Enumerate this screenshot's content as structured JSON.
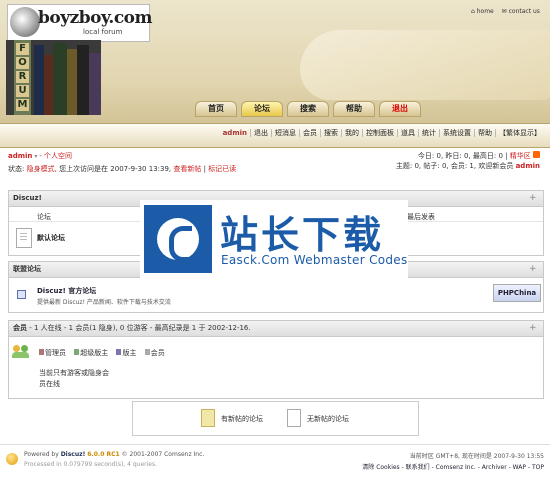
{
  "brand": {
    "title": "boyzboy.com",
    "subtitle": "local forum",
    "forum_letters": [
      "F",
      "O",
      "R",
      "U",
      "M"
    ]
  },
  "toplinks": {
    "home": "home",
    "contact": "contact us"
  },
  "nav": [
    {
      "label": "首页"
    },
    {
      "label": "论坛"
    },
    {
      "label": "搜索"
    },
    {
      "label": "帮助"
    },
    {
      "label": "退出"
    }
  ],
  "menu": [
    "admin",
    "退出",
    "短消息",
    "会员",
    "搜索",
    "我的",
    "控制面板",
    "道具",
    "统计",
    "系统设置",
    "帮助",
    "【繁体显示】"
  ],
  "user": {
    "name": "admin",
    "space": "- 个人空间",
    "status_prefix": "状态:",
    "status_mode": "隐身模式,",
    "last_visit": "您上次访问是在 2007-9-30 13:39,",
    "view_new": "查看新帖",
    "mark_read": "标记已读"
  },
  "stats": {
    "line1a": "今日: 0, 昨日: 0, 最高日: 0 |",
    "line1b": "精华区",
    "line2a": "主题: 0, 帖子: 0, 会员: 1, 欢迎新会员",
    "line2b": "admin"
  },
  "section1": {
    "title": "Discuz!",
    "col_forum": "论坛",
    "col_last": "最后发表",
    "forum_name": "默认论坛"
  },
  "section2": {
    "title": "联盟论坛",
    "link_title": "Discuz! 官方论坛",
    "link_desc": "提供最新 Discuz! 产品新闻、软件下载与技术交流",
    "partner": "PHPChina"
  },
  "online": {
    "title": "会员",
    "info": "- 1 人在线 - 1 会员(1 隐身), 0 位游客 - 最高纪录是 1 于 2002-12-16.",
    "legend": [
      "管理员",
      "超级版主",
      "版主",
      "会员"
    ],
    "line1": "当前只有游客或隐身会",
    "line2": "员在线"
  },
  "legend_box": {
    "new": "有新帖的论坛",
    "nonew": "无新帖的论坛"
  },
  "watermark": {
    "title": "站长下载",
    "subtitle": "Easck.Com Webmaster Codes"
  },
  "footer": {
    "powered": "Powered by",
    "product": "Discuz!",
    "version": "6.0.0 RC1",
    "copyright": "© 2001-2007 Comsenz Inc.",
    "processed": "Processed in 0.079799 second(s), 4 queries.",
    "tz": "当前时区 GMT+8, 现在时间是 2007-9-30 13:55",
    "links": "清除 Cookies - 联系我们 - Comsenz Inc. - Archiver - WAP - TOP"
  },
  "colors": {
    "accent": "#c22",
    "brand_blue": "#1b5ba8",
    "header_tan": "#d8c89a"
  }
}
